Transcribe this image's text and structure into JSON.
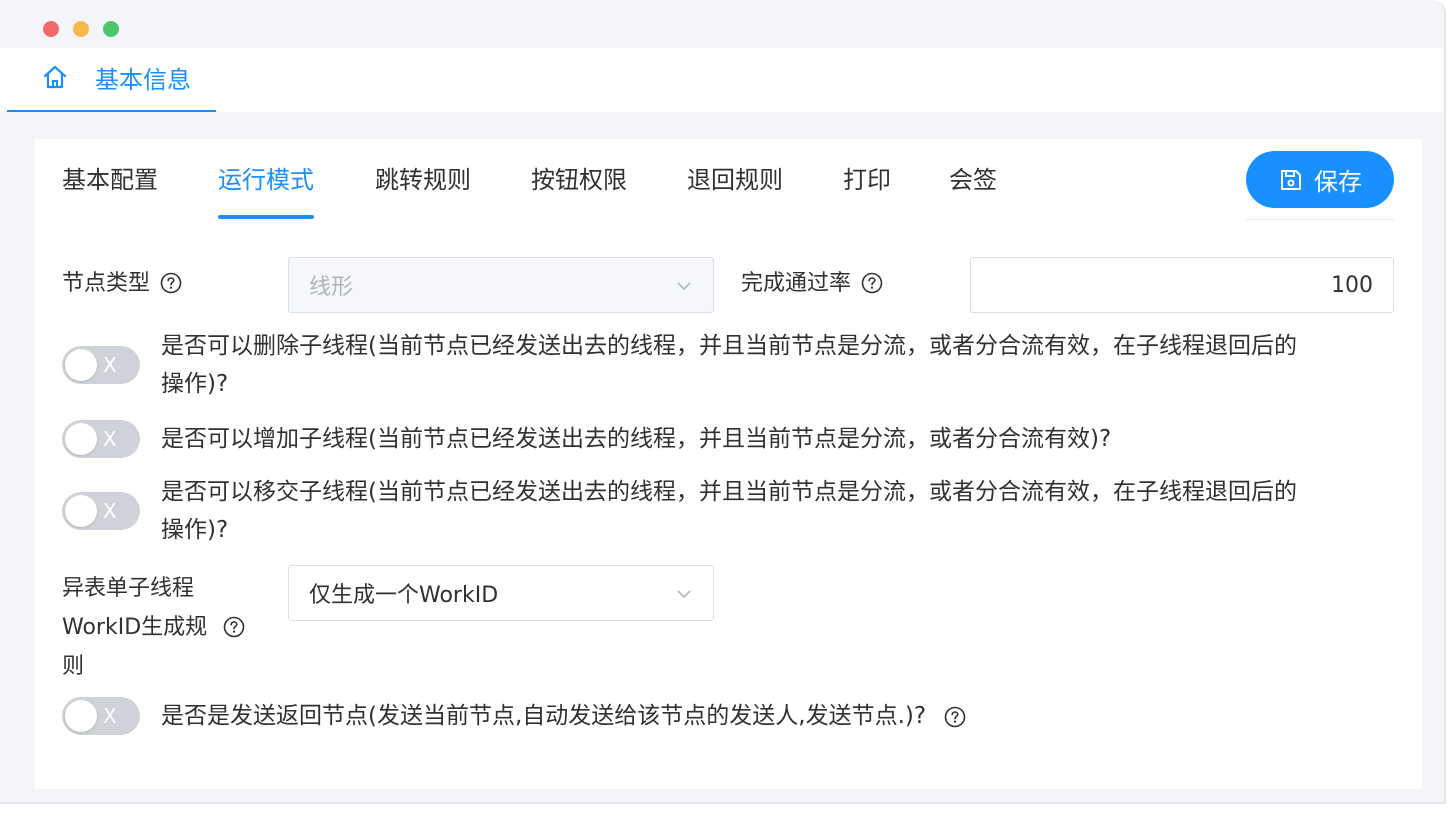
{
  "window": {
    "page_tab": {
      "label": "基本信息",
      "icon": "home-icon"
    }
  },
  "subtabs": [
    {
      "label": "基本配置",
      "active": false
    },
    {
      "label": "运行模式",
      "active": true
    },
    {
      "label": "跳转规则",
      "active": false
    },
    {
      "label": "按钮权限",
      "active": false
    },
    {
      "label": "退回规则",
      "active": false
    },
    {
      "label": "打印",
      "active": false
    },
    {
      "label": "会签",
      "active": false
    }
  ],
  "save_button": {
    "label": "保存",
    "icon": "save-icon"
  },
  "node_type": {
    "label": "节点类型",
    "value": "线形",
    "disabled": true
  },
  "pass_rate": {
    "label": "完成通过率",
    "value": "100"
  },
  "switches": {
    "delete_subthread": {
      "line1": "是否可以删除子线程(当前节点已经发送出去的线程，并且当前节点是分流，或者分合流有效，在子线程退回后的",
      "line2": "操作)?",
      "on": false
    },
    "add_subthread": {
      "line1": "是否可以增加子线程(当前节点已经发送出去的线程，并且当前节点是分流，或者分合流有效)?",
      "on": false
    },
    "transfer_subthread": {
      "line1": "是否可以移交子线程(当前节点已经发送出去的线程，并且当前节点是分流，或者分合流有效，在子线程退回后的",
      "line2": "操作)?",
      "on": false
    },
    "send_return_node": {
      "line1": "是否是发送返回节点(发送当前节点,自动发送给该节点的发送人,发送节点.)?",
      "on": false
    }
  },
  "switch_off_mark": "X",
  "workid_rule": {
    "label_line1": "异表单子线程",
    "label_line2": "WorkID生成规",
    "label_line3": "则",
    "value": "仅生成一个WorkID"
  },
  "colors": {
    "accent": "#1890ff",
    "switch_off": "#cfd2d8",
    "border": "#dcdfe6"
  }
}
